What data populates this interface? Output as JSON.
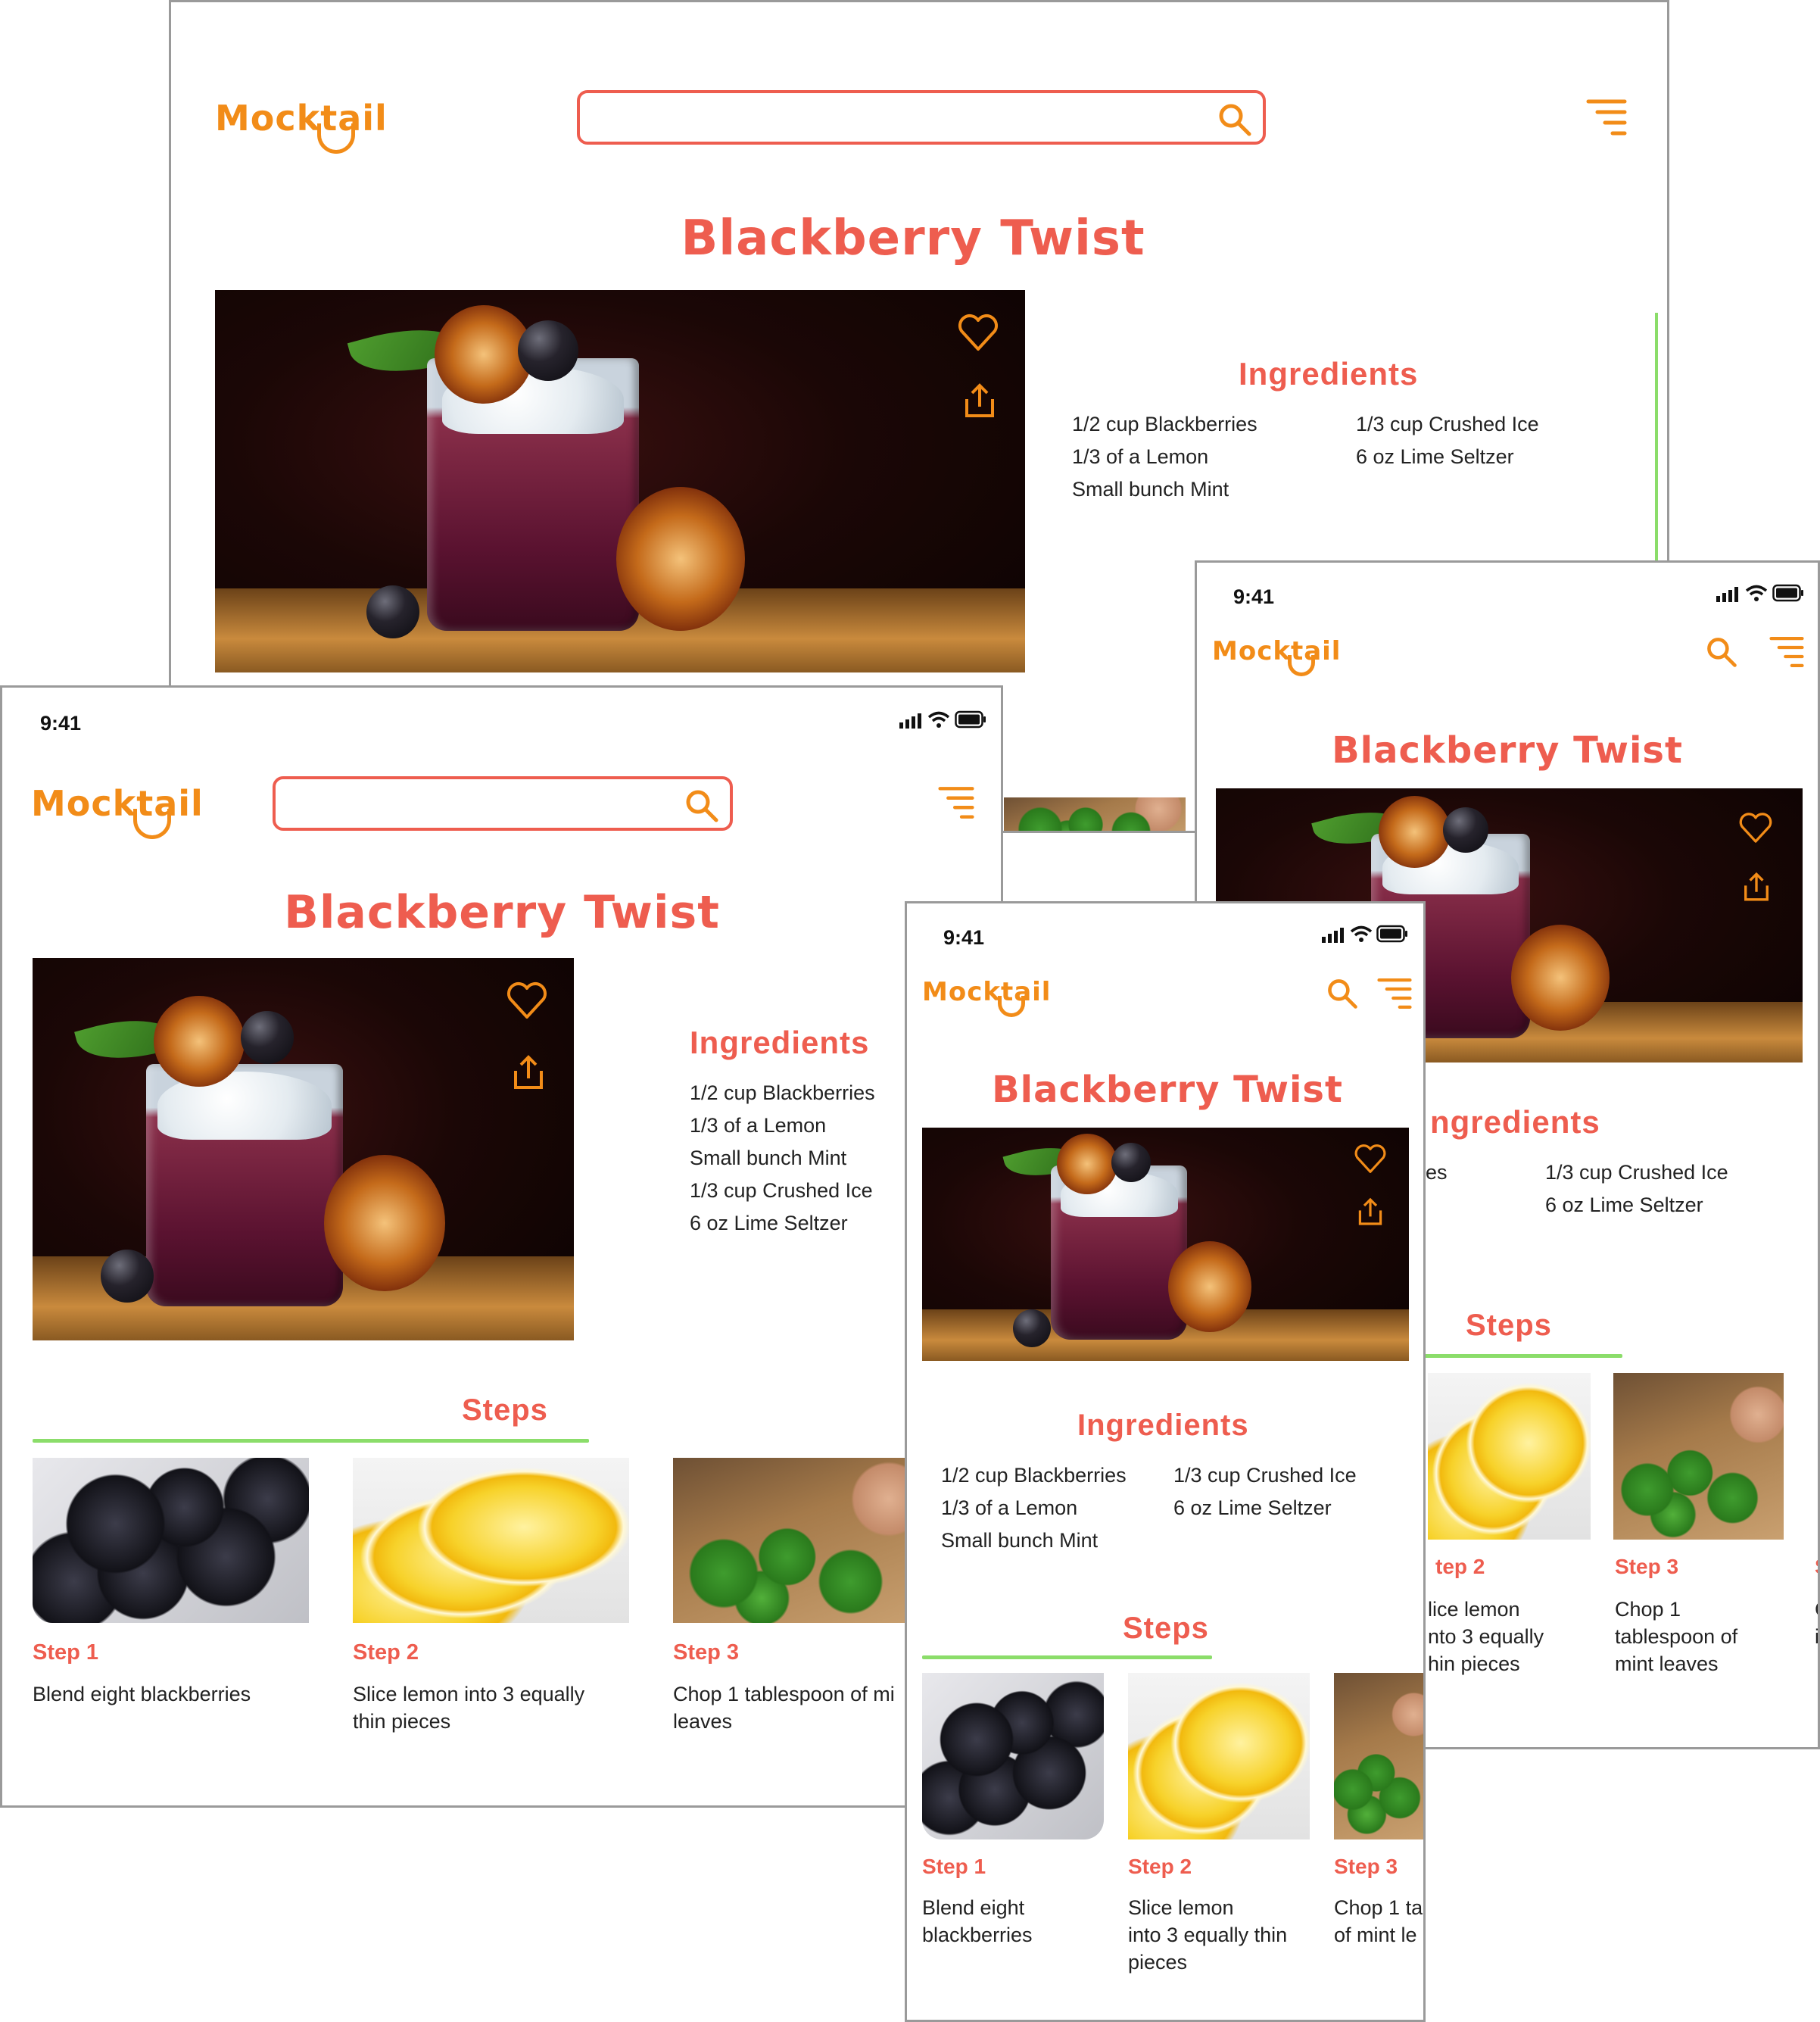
{
  "brand": {
    "logo": "Mocktail"
  },
  "recipe": {
    "title": "Blackberry Twist",
    "ingredients_heading": "Ingredients",
    "ingredients": [
      "1/2 cup Blackberries",
      "1/3 of a Lemon",
      "Small bunch Mint",
      "1/3 cup Crushed Ice",
      "6 oz Lime Seltzer"
    ],
    "steps_heading": "Steps",
    "steps": [
      {
        "label": "Step 1",
        "text": "Blend eight blackberries"
      },
      {
        "label": "Step 2",
        "text": "Slice lemon into 3 equally thin pieces"
      },
      {
        "label": "Step 3",
        "text": "Chop 1 tablespoon of mint leaves"
      }
    ]
  },
  "status_bar": {
    "time": "9:41"
  },
  "screens": {
    "tablet": {
      "step1_text": "Blend eight blackberries",
      "step2_text_line1": "Slice lemon into 3 equally",
      "step2_text_line2": "thin pieces",
      "step3_text_line1": "Chop 1 tablespoon of mi",
      "step3_text_line2": "leaves"
    },
    "phone_right": {
      "ing1_partial": "es",
      "ingredients_partial": "ngredients",
      "step2_label_partial": "tep 2",
      "step2_line1": "lice lemon",
      "step2_line2": "nto 3 equally",
      "step2_line3": "hin pieces",
      "step3_line1": "Chop 1",
      "step3_line2": "tablespoon of",
      "step3_line3": "mint leaves",
      "step4_partial1": "C",
      "step4_partial2": "i",
      "step4_label_partial": "S"
    },
    "phone_front": {
      "step1_line1": "Blend eight",
      "step1_line2": "blackberries",
      "step2_line1": "Slice lemon",
      "step2_line2": "into 3 equally thin",
      "step2_line3": "pieces",
      "step3_line1": "Chop 1 ta",
      "step3_line2": "of mint le"
    }
  },
  "colors": {
    "brand_orange": "#F28C18",
    "accent_red": "#EE5D4F",
    "accent_green": "#8BDD6A",
    "frame_gray": "#9A9A9A"
  },
  "icons": [
    "search-icon",
    "menu-icon",
    "heart-icon",
    "share-icon",
    "signal-icon",
    "wifi-icon",
    "battery-icon"
  ]
}
